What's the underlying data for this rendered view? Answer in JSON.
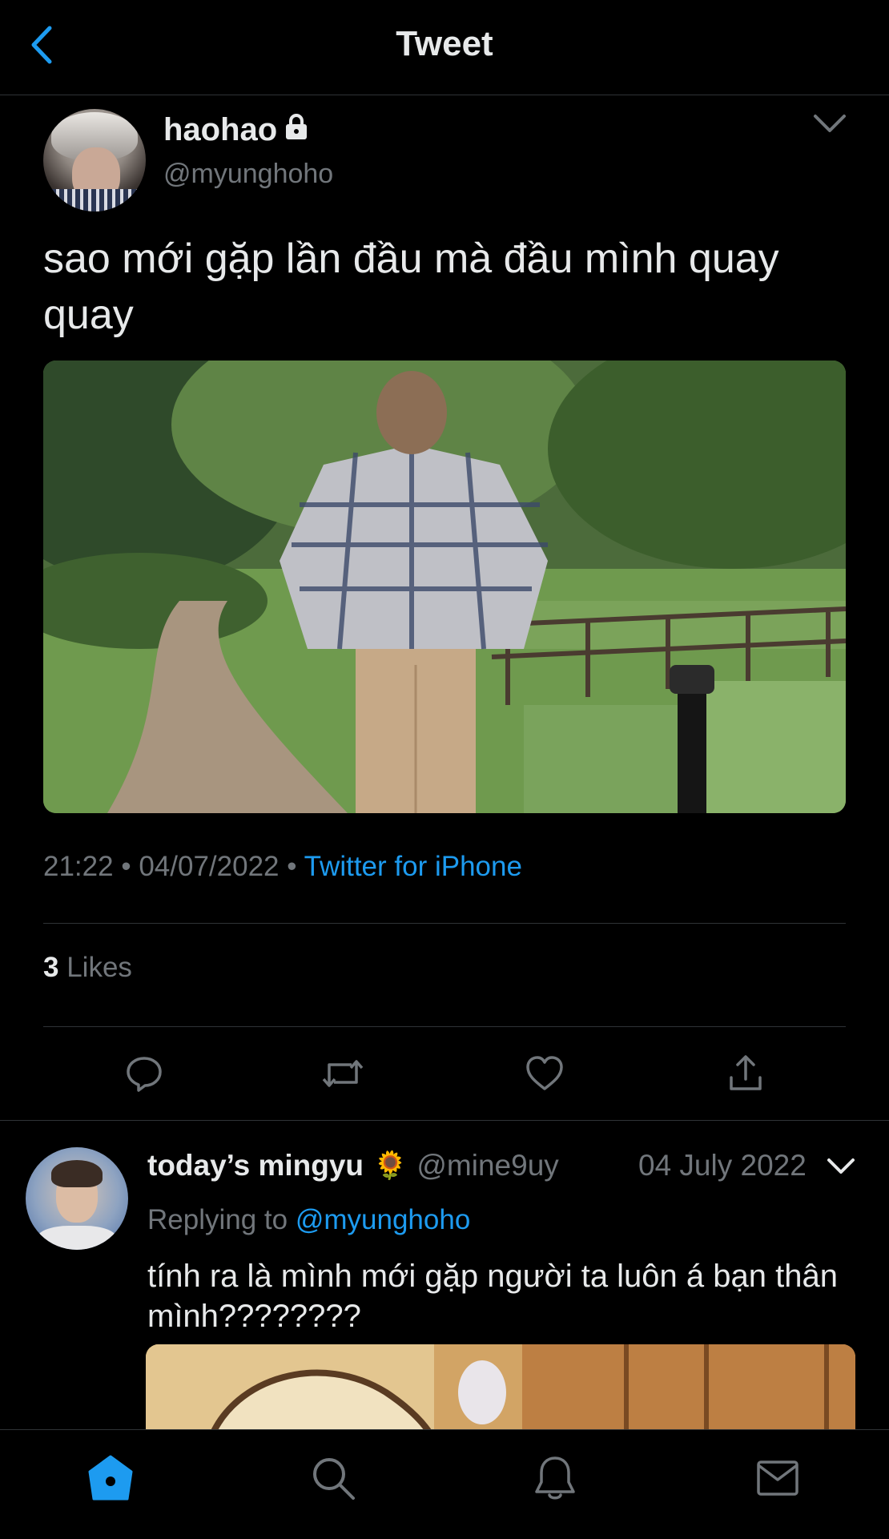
{
  "header": {
    "title": "Tweet"
  },
  "tweet": {
    "author_name": "haohao",
    "author_handle": "@myunghoho",
    "text": "sao mới gặp lần đầu mà đầu mình quay quay",
    "time": "21:22",
    "separator": "•",
    "date": "04/07/2022",
    "source": "Twitter for iPhone",
    "likes_count": "3",
    "likes_label": "Likes"
  },
  "reply": {
    "author_name": "today’s mingyu",
    "emoji": "🌻",
    "author_handle": "@mine9uy",
    "date": "04 July 2022",
    "replying_label": "Replying to",
    "replying_mention": "@myunghoho",
    "text": "tính ra là mình mới gặp người ta luôn á bạn thân mình????????"
  },
  "colors": {
    "background": "#000000",
    "accent": "#1d9bf0",
    "text_primary": "#e7e9ea",
    "text_secondary": "#71767b",
    "divider": "#2f3336"
  },
  "icons": {
    "back": "chevron-left-icon",
    "lock": "lock-icon",
    "more": "chevron-down-icon",
    "reply": "reply-icon",
    "retweet": "retweet-icon",
    "like": "heart-icon",
    "share": "share-icon",
    "home": "home-icon",
    "search": "search-icon",
    "notifications": "bell-icon",
    "messages": "mail-icon"
  }
}
